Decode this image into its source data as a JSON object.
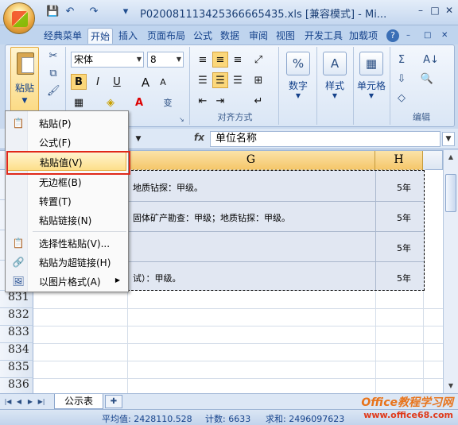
{
  "window": {
    "title": "P020081113425366665435.xls  [兼容模式] - Mi...",
    "min": "–",
    "max": "□",
    "close": "✕"
  },
  "quick_access": {
    "save": "💾",
    "undo": "↶",
    "redo": "↷",
    "more": "▾"
  },
  "tabs": [
    "经典菜单",
    "开始",
    "插入",
    "页面布局",
    "公式",
    "数据",
    "审阅",
    "视图",
    "开发工具",
    "加载项"
  ],
  "active_tab": "开始",
  "help_icon": "?",
  "ribbon": {
    "paste_label": "粘贴",
    "font_name": "宋体",
    "font_size": "8",
    "bold": "B",
    "italic": "I",
    "underline": "U",
    "grow_font": "A",
    "shrink_font": "A",
    "align_group_label": "对齐方式",
    "number_label": "数字",
    "styles_label": "样式",
    "cells_label": "单元格",
    "editing_label": "编辑",
    "number_icon": "%",
    "sum_icon": "Σ",
    "sort_icon": "A↓",
    "phonetic": "变"
  },
  "formula_bar": {
    "fx": "fx",
    "content": "单位名称"
  },
  "columns": [
    {
      "id": "G",
      "label": "G"
    },
    {
      "id": "H",
      "label": "H"
    }
  ],
  "rows": [
    {
      "g": "地质钻探：甲级。",
      "h": "5年"
    },
    {
      "g": "固体矿产勘查：甲级；地质钻探：甲级。",
      "h": "5年"
    },
    {
      "g": "",
      "h": "5年"
    },
    {
      "g": "试）：甲级。",
      "h": "5年"
    }
  ],
  "row_numbers": [
    "831",
    "832",
    "833",
    "834",
    "835",
    "836"
  ],
  "context_menu": [
    {
      "label": "粘贴(P)",
      "icon": "paste-icon"
    },
    {
      "label": "公式(F)",
      "icon": ""
    },
    {
      "label": "粘贴值(V)",
      "icon": "",
      "highlighted": true
    },
    {
      "label": "无边框(B)",
      "icon": ""
    },
    {
      "label": "转置(T)",
      "icon": ""
    },
    {
      "label": "粘贴链接(N)",
      "icon": ""
    },
    {
      "label": "选择性粘贴(V)...",
      "icon": "paste-special-icon"
    },
    {
      "label": "粘贴为超链接(H)",
      "icon": "paste-hyperlink-icon"
    },
    {
      "label": "以图片格式(A)",
      "icon": "picture-icon",
      "submenu": true
    }
  ],
  "sheet_tab": "公示表",
  "status": {
    "average": "平均值: 2428110.528",
    "count": "计数: 6633",
    "sum": "求和: 2496097623"
  },
  "watermark": {
    "line1": "Office教程学习网",
    "line2": "www.office68.com"
  },
  "colors": {
    "accent": "#f5c76b",
    "highlight_border": "#e0281a",
    "ribbon": "#dae6f5"
  }
}
